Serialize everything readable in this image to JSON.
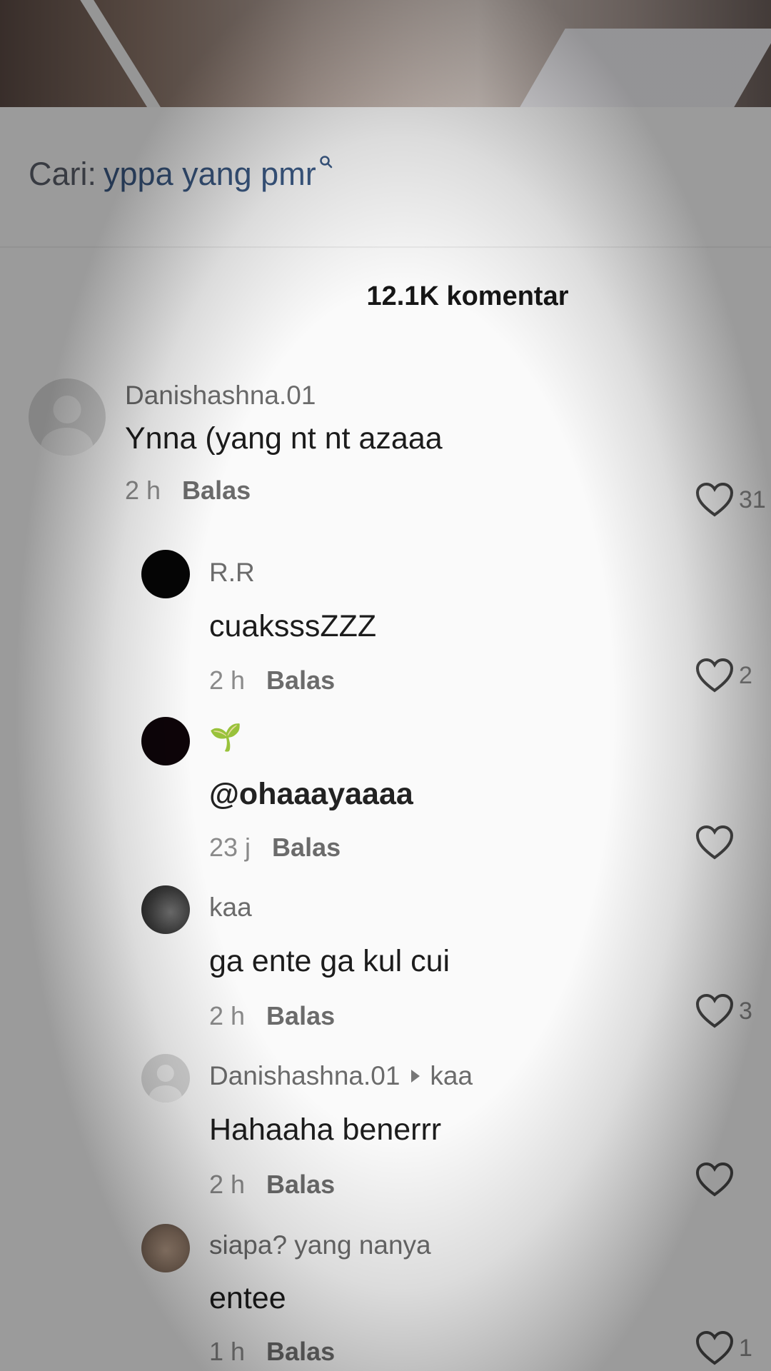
{
  "search": {
    "prefix": "Cari:",
    "query": "yppa yang pmr",
    "icon": "search-icon"
  },
  "comments_header": {
    "count_label": "12.1K komentar"
  },
  "comments": [
    {
      "username": "Danishashna.01",
      "text": "Ynna (yang nt nt azaaa",
      "time": "2 h",
      "reply_label": "Balas",
      "likes": "31",
      "avatar": "default-avatar"
    },
    {
      "username": "R.R",
      "text": "cuaksssZZZ",
      "time": "2 h",
      "reply_label": "Balas",
      "likes": "2",
      "avatar": "black-avatar"
    },
    {
      "username": "🌱",
      "text": "@ohaaayaaaa",
      "time": "23 j",
      "reply_label": "Balas",
      "likes": "",
      "avatar": "dark-avatar"
    },
    {
      "username": "kaa",
      "text": "ga ente ga kul cui",
      "time": "2 h",
      "reply_label": "Balas",
      "likes": "3",
      "avatar": "photo-avatar"
    },
    {
      "username": "Danishashna.01",
      "reply_to": "kaa",
      "text": "Hahaaha benerrr",
      "time": "2 h",
      "reply_label": "Balas",
      "likes": "",
      "avatar": "default-avatar"
    },
    {
      "username": "siapa? yang nanya",
      "text": "entee",
      "time": "1 h",
      "reply_label": "Balas",
      "likes": "1",
      "avatar": "cat-avatar"
    }
  ]
}
